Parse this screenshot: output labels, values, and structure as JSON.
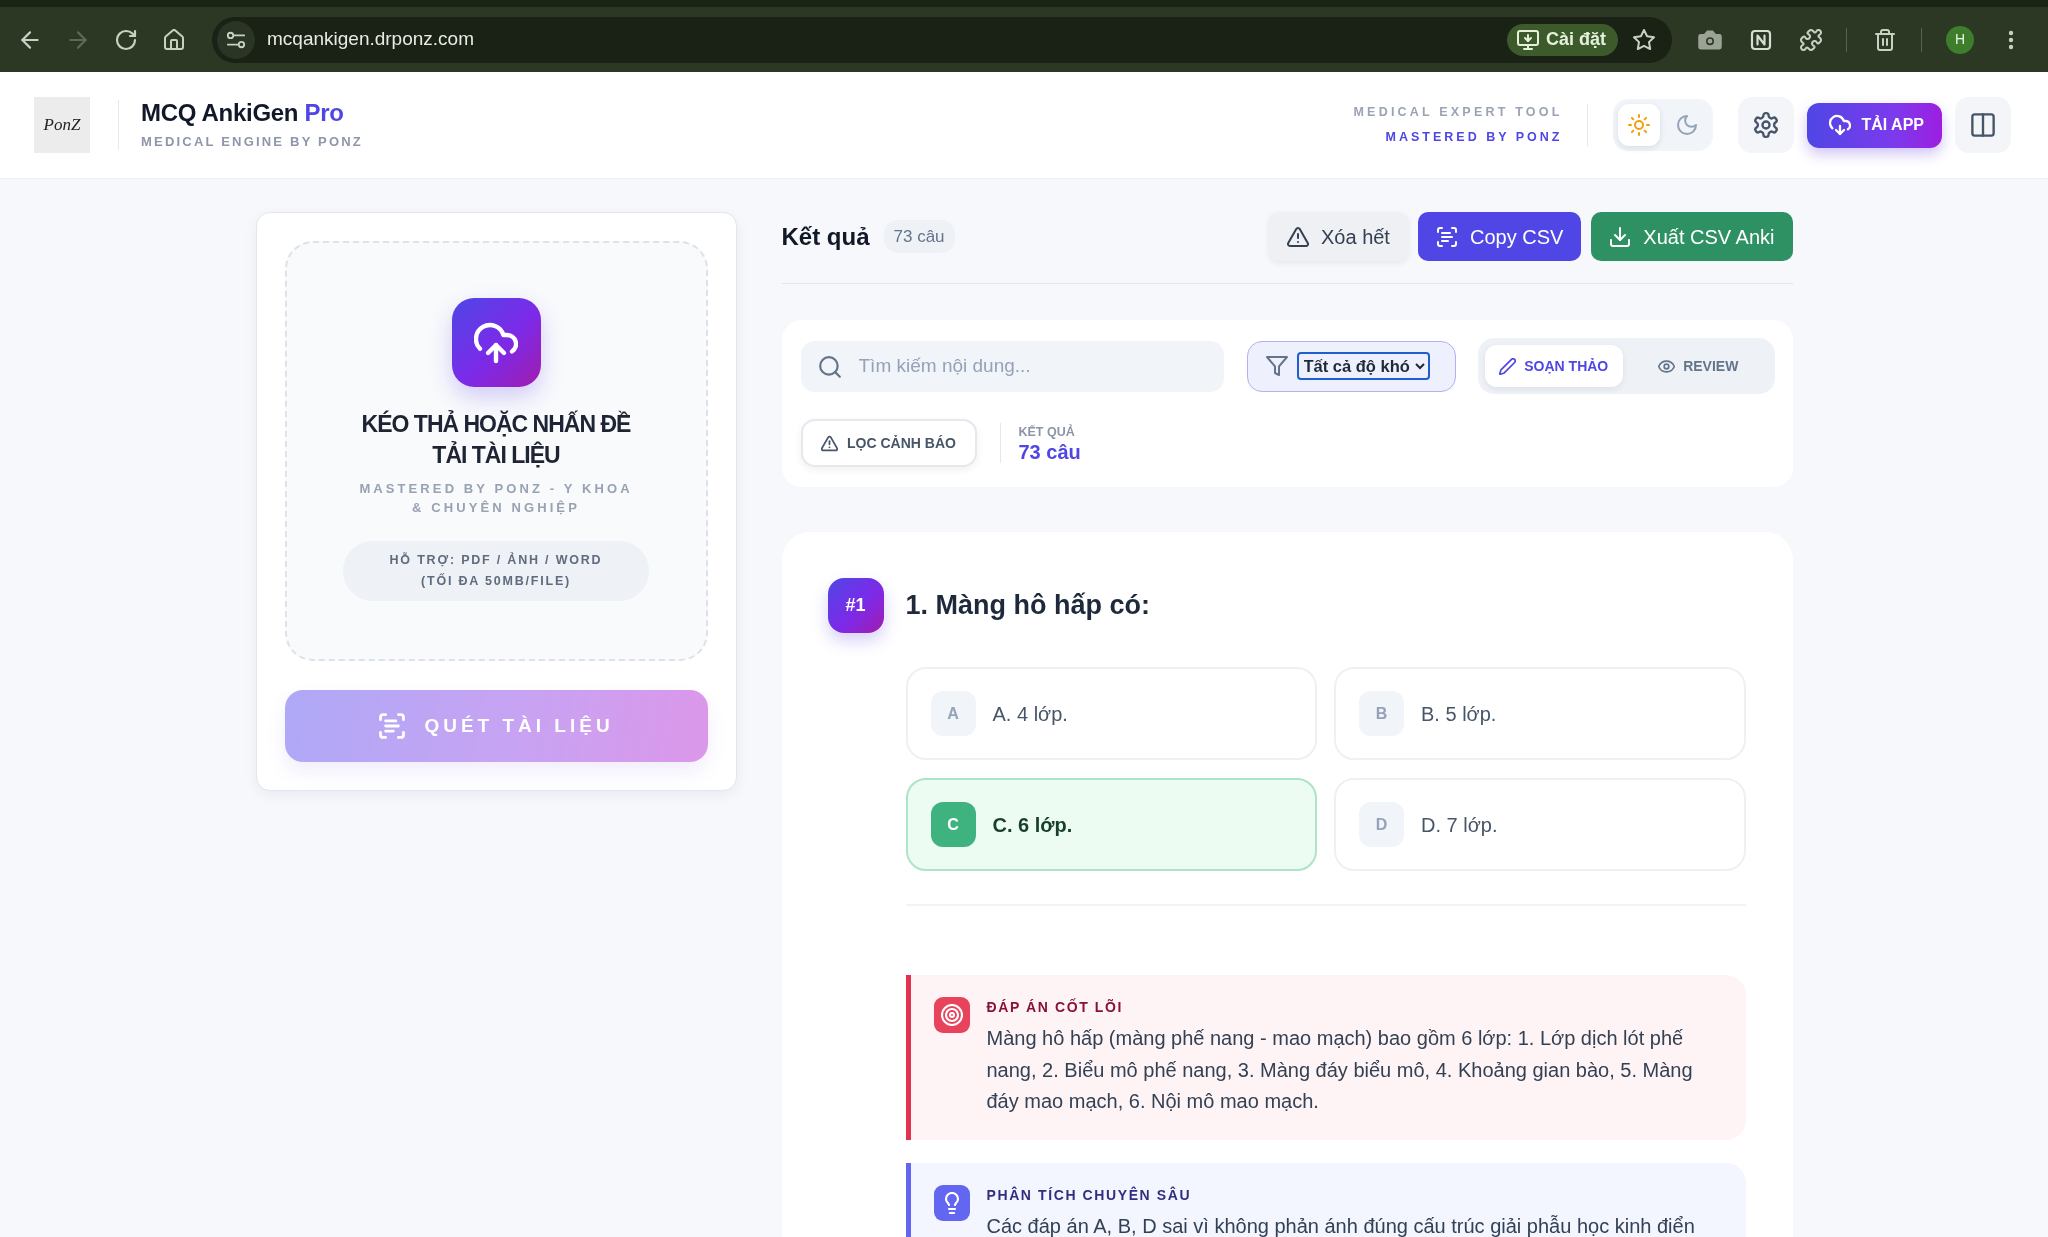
{
  "browser": {
    "url": "mcqankigen.drponz.com",
    "install_label": "Cài đặt",
    "profile_initial": "H",
    "forward_disabled": true
  },
  "header": {
    "logo_text": "PonZ",
    "title": "MCQ AnkiGen",
    "title_accent": "Pro",
    "subtitle": "MEDICAL ENGINE BY PONZ",
    "tagline": "MEDICAL EXPERT TOOL",
    "tagline_strong": "MASTERED BY PONZ",
    "theme_modes": [
      {
        "kind": "light",
        "selected": true
      },
      {
        "kind": "dark",
        "selected": false
      }
    ],
    "app_button": "TẢI APP"
  },
  "upload": {
    "title": "KÉO THẢ HOẶC NHẤN ĐỀ TẢI TÀI LIỆU",
    "subtitle": "MASTERED BY PONZ - Y KHOA & CHUYÊN NGHIỆP",
    "formats": "HỖ TRỢ: PDF / ẢNH / WORD (TỐI ĐA 50MB/FILE)",
    "scan_button": {
      "label": "QUÉT TÀI LIỆU",
      "disabled": true
    }
  },
  "results": {
    "title": "Kết quả",
    "count": "73 câu",
    "actions": [
      {
        "kind": "clear",
        "label": "Xóa hết"
      },
      {
        "kind": "copy",
        "label": "Copy CSV"
      },
      {
        "kind": "export",
        "label": "Xuất CSV Anki"
      }
    ]
  },
  "filters": {
    "search": {
      "placeholder": "Tìm kiếm nội dung..."
    },
    "difficulty": "Tất cả độ khó",
    "modes": [
      {
        "kind": "edit",
        "label": "SOẠN THẢO",
        "selected": true
      },
      {
        "kind": "review",
        "label": "REVIEW",
        "selected": false
      }
    ],
    "warning_filter": "LỌC CẢNH BÁO",
    "result_label": "KẾT QUẢ",
    "result_count": "73 câu"
  },
  "questions": [
    {
      "badge": "#1",
      "text": "1. Màng hô hấp có:",
      "options": [
        {
          "letter": "A",
          "text": "A. 4 lớp.",
          "correct": false
        },
        {
          "letter": "B",
          "text": "B. 5 lớp.",
          "correct": false
        },
        {
          "letter": "C",
          "text": "C. 6 lớp.",
          "correct": true
        },
        {
          "letter": "D",
          "text": "D. 7 lớp.",
          "correct": false
        }
      ],
      "notes": [
        {
          "kind": "answer",
          "label": "ĐÁP ÁN CỐT LÕI",
          "text": "Màng hô hấp (màng phế nang - mao mạch) bao gồm 6 lớp: 1. Lớp dịch lót phế nang, 2. Biểu mô phế nang, 3. Màng đáy biểu mô, 4. Khoảng gian bào, 5. Màng đáy mao mạch, 6. Nội mô mao mạch."
        },
        {
          "kind": "analysis",
          "label": "PHÂN TÍCH CHUYÊN SÂU",
          "text": "Các đáp án A, B, D sai vì không phản ánh đúng cấu trúc giải phẫu học kinh điển"
        }
      ]
    }
  ]
}
